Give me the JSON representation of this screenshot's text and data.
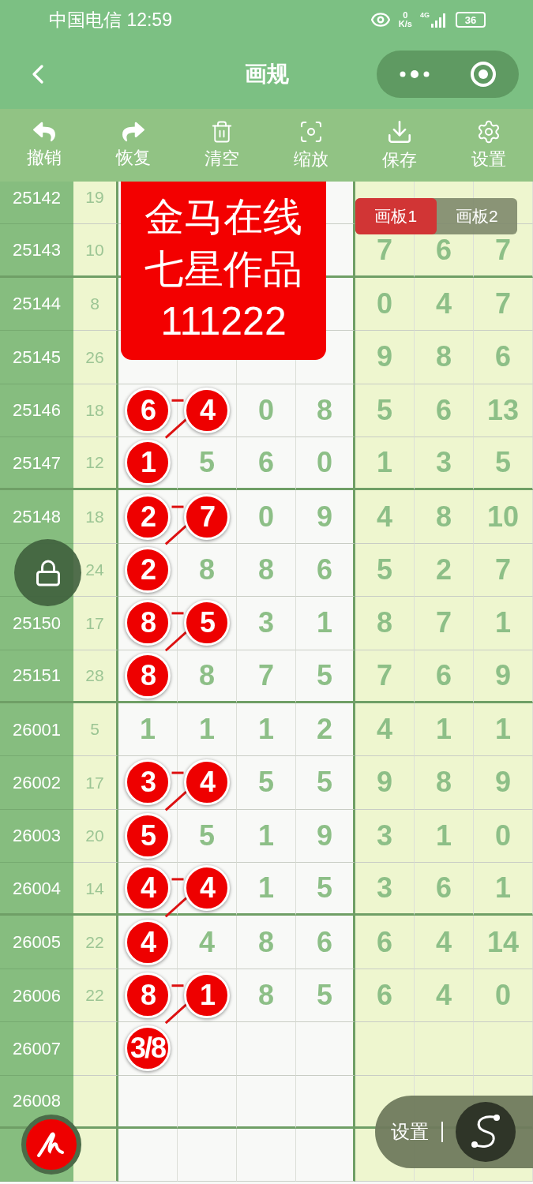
{
  "status_bar": {
    "carrier_time": "中国电信 12:59",
    "speed_value": "0",
    "speed_unit": "K/s",
    "network": "4G",
    "battery": "36"
  },
  "nav": {
    "title": "画规"
  },
  "toolbar": [
    {
      "kind": "undo",
      "label": "撤销"
    },
    {
      "kind": "redo",
      "label": "恢复"
    },
    {
      "kind": "clear",
      "label": "清空"
    },
    {
      "kind": "zoom",
      "label": "缩放"
    },
    {
      "kind": "save",
      "label": "保存"
    },
    {
      "kind": "settings",
      "label": "设置"
    }
  ],
  "rows": [
    {
      "issue": "25142",
      "sum": "19",
      "cells": [
        null,
        null,
        null,
        null,
        null,
        null,
        null
      ]
    },
    {
      "issue": "25143",
      "sum": "10",
      "cells": [
        null,
        null,
        null,
        null,
        {
          "kind": "plain",
          "text": "7"
        },
        {
          "kind": "plain",
          "text": "6"
        },
        {
          "kind": "plain",
          "text": "7"
        }
      ]
    },
    {
      "issue": "25144",
      "sum": "8",
      "cells": [
        null,
        null,
        null,
        null,
        {
          "kind": "plain",
          "text": "0"
        },
        {
          "kind": "plain",
          "text": "4"
        },
        {
          "kind": "plain",
          "text": "7"
        }
      ]
    },
    {
      "issue": "25145",
      "sum": "26",
      "cells": [
        null,
        null,
        null,
        null,
        {
          "kind": "plain",
          "text": "9"
        },
        {
          "kind": "plain",
          "text": "8"
        },
        {
          "kind": "plain",
          "text": "6"
        }
      ]
    },
    {
      "issue": "25146",
      "sum": "18",
      "cells": [
        {
          "kind": "ball",
          "text": "6"
        },
        {
          "kind": "ball",
          "text": "4"
        },
        {
          "kind": "plain",
          "text": "0"
        },
        {
          "kind": "plain",
          "text": "8"
        },
        {
          "kind": "plain",
          "text": "5"
        },
        {
          "kind": "plain",
          "text": "6"
        },
        {
          "kind": "plain",
          "text": "13"
        }
      ]
    },
    {
      "issue": "25147",
      "sum": "12",
      "cells": [
        {
          "kind": "ball",
          "text": "1"
        },
        {
          "kind": "plain",
          "text": "5"
        },
        {
          "kind": "plain",
          "text": "6"
        },
        {
          "kind": "plain",
          "text": "0"
        },
        {
          "kind": "plain",
          "text": "1"
        },
        {
          "kind": "plain",
          "text": "3"
        },
        {
          "kind": "plain",
          "text": "5"
        }
      ]
    },
    {
      "issue": "25148",
      "sum": "18",
      "cells": [
        {
          "kind": "ball",
          "text": "2"
        },
        {
          "kind": "ball",
          "text": "7"
        },
        {
          "kind": "plain",
          "text": "0"
        },
        {
          "kind": "plain",
          "text": "9"
        },
        {
          "kind": "plain",
          "text": "4"
        },
        {
          "kind": "plain",
          "text": "8"
        },
        {
          "kind": "plain",
          "text": "10"
        }
      ]
    },
    {
      "issue": null,
      "sum": "24",
      "cells": [
        {
          "kind": "ball",
          "text": "2"
        },
        {
          "kind": "plain",
          "text": "8"
        },
        {
          "kind": "plain",
          "text": "8"
        },
        {
          "kind": "plain",
          "text": "6"
        },
        {
          "kind": "plain",
          "text": "5"
        },
        {
          "kind": "plain",
          "text": "2"
        },
        {
          "kind": "plain",
          "text": "7"
        }
      ]
    },
    {
      "issue": "25150",
      "sum": "17",
      "cells": [
        {
          "kind": "ball",
          "text": "8"
        },
        {
          "kind": "ball",
          "text": "5"
        },
        {
          "kind": "plain",
          "text": "3"
        },
        {
          "kind": "plain",
          "text": "1"
        },
        {
          "kind": "plain",
          "text": "8"
        },
        {
          "kind": "plain",
          "text": "7"
        },
        {
          "kind": "plain",
          "text": "1"
        }
      ]
    },
    {
      "issue": "25151",
      "sum": "28",
      "cells": [
        {
          "kind": "ball",
          "text": "8"
        },
        {
          "kind": "plain",
          "text": "8"
        },
        {
          "kind": "plain",
          "text": "7"
        },
        {
          "kind": "plain",
          "text": "5"
        },
        {
          "kind": "plain",
          "text": "7"
        },
        {
          "kind": "plain",
          "text": "6"
        },
        {
          "kind": "plain",
          "text": "9"
        }
      ]
    },
    {
      "issue": "26001",
      "sum": "5",
      "cells": [
        {
          "kind": "plain",
          "text": "1"
        },
        {
          "kind": "plain",
          "text": "1"
        },
        {
          "kind": "plain",
          "text": "1"
        },
        {
          "kind": "plain",
          "text": "2"
        },
        {
          "kind": "plain",
          "text": "4"
        },
        {
          "kind": "plain",
          "text": "1"
        },
        {
          "kind": "plain",
          "text": "1"
        }
      ]
    },
    {
      "issue": "26002",
      "sum": "17",
      "cells": [
        {
          "kind": "ball",
          "text": "3"
        },
        {
          "kind": "ball",
          "text": "4"
        },
        {
          "kind": "plain",
          "text": "5"
        },
        {
          "kind": "plain",
          "text": "5"
        },
        {
          "kind": "plain",
          "text": "9"
        },
        {
          "kind": "plain",
          "text": "8"
        },
        {
          "kind": "plain",
          "text": "9"
        }
      ]
    },
    {
      "issue": "26003",
      "sum": "20",
      "cells": [
        {
          "kind": "ball",
          "text": "5"
        },
        {
          "kind": "plain",
          "text": "5"
        },
        {
          "kind": "plain",
          "text": "1"
        },
        {
          "kind": "plain",
          "text": "9"
        },
        {
          "kind": "plain",
          "text": "3"
        },
        {
          "kind": "plain",
          "text": "1"
        },
        {
          "kind": "plain",
          "text": "0"
        }
      ]
    },
    {
      "issue": "26004",
      "sum": "14",
      "cells": [
        {
          "kind": "ball",
          "text": "4"
        },
        {
          "kind": "ball",
          "text": "4"
        },
        {
          "kind": "plain",
          "text": "1"
        },
        {
          "kind": "plain",
          "text": "5"
        },
        {
          "kind": "plain",
          "text": "3"
        },
        {
          "kind": "plain",
          "text": "6"
        },
        {
          "kind": "plain",
          "text": "1"
        }
      ]
    },
    {
      "issue": "26005",
      "sum": "22",
      "cells": [
        {
          "kind": "ball",
          "text": "4"
        },
        {
          "kind": "plain",
          "text": "4"
        },
        {
          "kind": "plain",
          "text": "8"
        },
        {
          "kind": "plain",
          "text": "6"
        },
        {
          "kind": "plain",
          "text": "6"
        },
        {
          "kind": "plain",
          "text": "4"
        },
        {
          "kind": "plain",
          "text": "14"
        }
      ]
    },
    {
      "issue": "26006",
      "sum": "22",
      "cells": [
        {
          "kind": "ball",
          "text": "8"
        },
        {
          "kind": "ball",
          "text": "1"
        },
        {
          "kind": "plain",
          "text": "8"
        },
        {
          "kind": "plain",
          "text": "5"
        },
        {
          "kind": "plain",
          "text": "6"
        },
        {
          "kind": "plain",
          "text": "4"
        },
        {
          "kind": "plain",
          "text": "0"
        }
      ]
    },
    {
      "issue": "26007",
      "sum": null,
      "cells": [
        {
          "kind": "ball",
          "text": "3/8"
        },
        null,
        null,
        null,
        null,
        null,
        null
      ]
    },
    {
      "issue": "26008",
      "sum": null,
      "cells": [
        null,
        null,
        null,
        null,
        null,
        null,
        null
      ]
    },
    {
      "issue": null,
      "sum": null,
      "cells": [
        null,
        null,
        null,
        null,
        null,
        null,
        null
      ]
    }
  ],
  "overlay_card": {
    "lines": [
      "金马在线",
      "七星作品",
      "111222"
    ]
  },
  "board_tabs": [
    {
      "label": "画板1",
      "selected": true
    },
    {
      "label": "画板2",
      "selected": false
    }
  ],
  "settings_pill": {
    "label": "设置"
  }
}
